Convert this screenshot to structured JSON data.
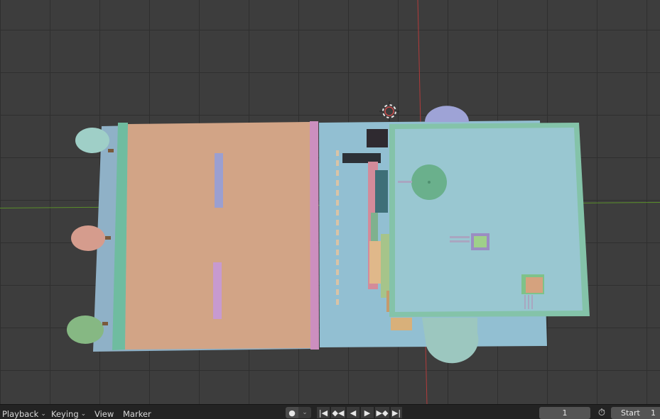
{
  "timeline": {
    "menus": [
      "Playback",
      "Keying",
      "View",
      "Marker"
    ],
    "current_frame": "1",
    "start_label": "Start",
    "start_value": "1"
  },
  "icons": [
    "record-icon",
    "chevron-down-icon",
    "jump-to-start-icon",
    "prev-keyframe-icon",
    "play-reverse-icon",
    "play-icon",
    "next-keyframe-icon",
    "jump-to-end-icon",
    "stopwatch-icon",
    "3d-cursor-icon"
  ],
  "colors": {
    "grid_bg": "#3d3d3d",
    "axis_x": "#5a8f2a",
    "axis_y": "#b23b3b",
    "floor_blue": "#8fb1c7",
    "road_peach": "#d2a486",
    "wall_green": "#7fc2a2",
    "divider_pink": "#c98bbb"
  }
}
